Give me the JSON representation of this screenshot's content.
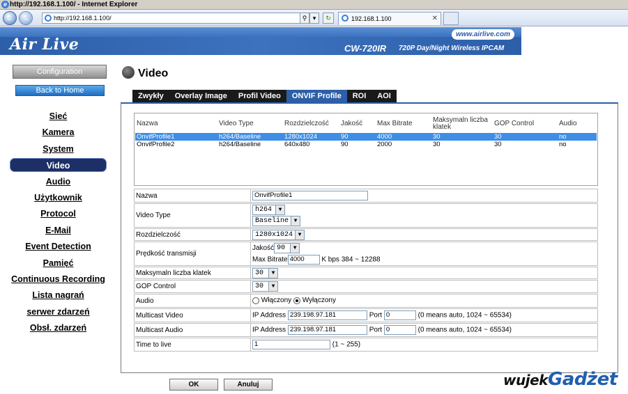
{
  "browser": {
    "window_title": "http://192.168.1.100/ - Internet Explorer",
    "address": "http://192.168.1.100/",
    "tab_title": "192.168.1.100"
  },
  "banner": {
    "logo": "Air Live",
    "url": "www.airlive.com",
    "model": "CW-720IR",
    "model_desc": "720P Day/Night Wireless IPCAM"
  },
  "sidebar": {
    "config_label": "Configuration",
    "home_label": "Back to Home",
    "items": [
      {
        "label": "Sieć",
        "active": false
      },
      {
        "label": "Kamera",
        "active": false
      },
      {
        "label": "System",
        "active": false
      },
      {
        "label": "Video",
        "active": true
      },
      {
        "label": "Audio",
        "active": false
      },
      {
        "label": "Użytkownik",
        "active": false
      },
      {
        "label": "Protocol",
        "active": false
      },
      {
        "label": "E-Mail",
        "active": false
      },
      {
        "label": "Event Detection",
        "active": false
      },
      {
        "label": "Pamięć",
        "active": false
      },
      {
        "label": "Continuous Recording",
        "active": false
      },
      {
        "label": "Lista nagrań",
        "active": false
      },
      {
        "label": "serwer zdarzeń",
        "active": false
      },
      {
        "label": "Obsł. zdarzeń",
        "active": false
      }
    ]
  },
  "page": {
    "title": "Video",
    "tabs": [
      "Zwykły",
      "Overlay Image",
      "Profil Video",
      "ONVIF Profile",
      "ROI",
      "AOI"
    ],
    "active_tab": "ONVIF Profile"
  },
  "profiles": {
    "headers": [
      "Nazwa",
      "Video Type",
      "Rozdzielczość",
      "Jakość",
      "Max Bitrate",
      "Maksymaln liczba klatek",
      "GOP Control",
      "Audio"
    ],
    "rows": [
      [
        "OnvifProfile1",
        "h264/Baseline",
        "1280x1024",
        "90",
        "4000",
        "30",
        "30",
        "no"
      ],
      [
        "OnvifProfile2",
        "h264/Baseline",
        "640x480",
        "90",
        "2000",
        "30",
        "30",
        "no"
      ]
    ]
  },
  "form": {
    "name_label": "Nazwa",
    "name_value": "OnvifProfile1",
    "video_type_label": "Video Type",
    "codec": "h264",
    "profile": "Baseline",
    "resolution_label": "Rozdzielczość",
    "resolution": "1280x1024",
    "speed_label": "Prędkość transmisji",
    "quality_label": "Jakość",
    "quality": "90",
    "bitrate_label": "Max Bitrate",
    "bitrate": "4000",
    "bitrate_hint": "K bps 384 ~ 12288",
    "fps_label": "Maksymaln liczba klatek",
    "fps": "30",
    "gop_label": "GOP Control",
    "gop": "30",
    "audio_label": "Audio",
    "audio_on": "Włączony",
    "audio_off": "Wyłączony",
    "mc_video_label": "Multicast Video",
    "mc_audio_label": "Multicast Audio",
    "ip_label": "IP Address",
    "mc_video_ip": "239.198.97.181",
    "mc_audio_ip": "239.198.97.181",
    "port_label": "Port",
    "mc_video_port": "0",
    "mc_audio_port": "0",
    "port_hint": "(0 means auto, 1024 ~ 65534)",
    "ttl_label": "Time to live",
    "ttl": "1",
    "ttl_hint": "(1 ~ 255)"
  },
  "buttons": {
    "ok": "OK",
    "cancel": "Anuluj"
  },
  "watermark": {
    "part1": "wujek",
    "part2": "Gadżet"
  }
}
